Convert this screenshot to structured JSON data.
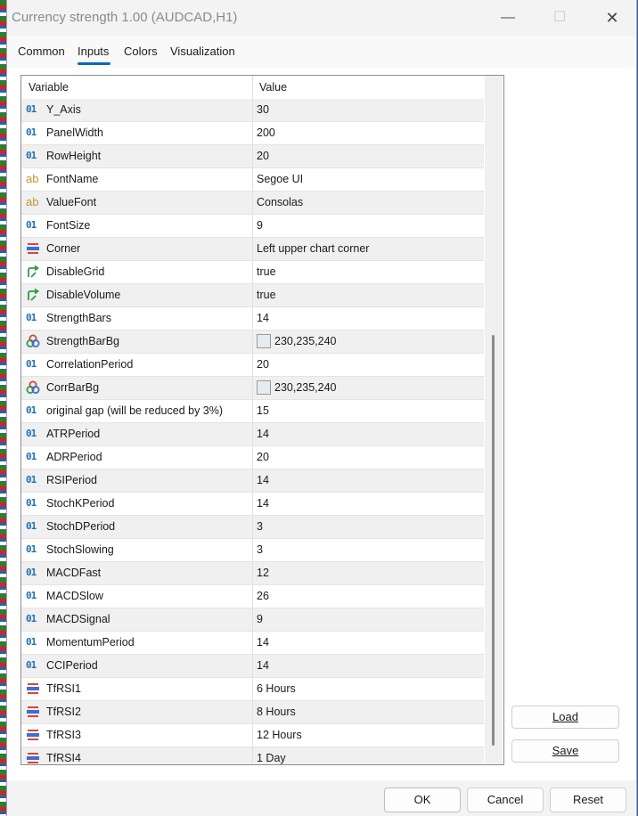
{
  "window": {
    "title": "Currency strength 1.00 (AUDCAD,H1)",
    "minimize_glyph": "—",
    "maximize_glyph": "☐",
    "close_glyph": "✕"
  },
  "tabs": [
    {
      "label": "Common"
    },
    {
      "label": "Inputs",
      "active": true
    },
    {
      "label": "Colors"
    },
    {
      "label": "Visualization"
    }
  ],
  "grid": {
    "col_variable": "Variable",
    "col_value": "Value",
    "rows": [
      {
        "icon": "integer-icon",
        "name": "Y_Axis",
        "value": "30"
      },
      {
        "icon": "integer-icon",
        "name": "PanelWidth",
        "value": "200"
      },
      {
        "icon": "integer-icon",
        "name": "RowHeight",
        "value": "20"
      },
      {
        "icon": "string-icon",
        "name": "FontName",
        "value": "Segoe UI"
      },
      {
        "icon": "string-icon",
        "name": "ValueFont",
        "value": "Consolas"
      },
      {
        "icon": "integer-icon",
        "name": "FontSize",
        "value": "9"
      },
      {
        "icon": "enum-icon",
        "name": "Corner",
        "value": "Left upper chart corner"
      },
      {
        "icon": "bool-icon",
        "name": "DisableGrid",
        "value": "true"
      },
      {
        "icon": "bool-icon",
        "name": "DisableVolume",
        "value": "true"
      },
      {
        "icon": "integer-icon",
        "name": "StrengthBars",
        "value": "14"
      },
      {
        "icon": "color-icon",
        "name": "StrengthBarBg",
        "value": "230,235,240",
        "swatch": "#e6ebf0"
      },
      {
        "icon": "integer-icon",
        "name": "CorrelationPeriod",
        "value": "20"
      },
      {
        "icon": "color-icon",
        "name": "CorrBarBg",
        "value": "230,235,240",
        "swatch": "#e6ebf0"
      },
      {
        "icon": "integer-icon",
        "name": "original gap (will be reduced by 3%)",
        "value": "15"
      },
      {
        "icon": "integer-icon",
        "name": "ATRPeriod",
        "value": "14"
      },
      {
        "icon": "integer-icon",
        "name": "ADRPeriod",
        "value": "20"
      },
      {
        "icon": "integer-icon",
        "name": "RSIPeriod",
        "value": "14"
      },
      {
        "icon": "integer-icon",
        "name": "StochKPeriod",
        "value": "14"
      },
      {
        "icon": "integer-icon",
        "name": "StochDPeriod",
        "value": "3"
      },
      {
        "icon": "integer-icon",
        "name": "StochSlowing",
        "value": "3"
      },
      {
        "icon": "integer-icon",
        "name": "MACDFast",
        "value": "12"
      },
      {
        "icon": "integer-icon",
        "name": "MACDSlow",
        "value": "26"
      },
      {
        "icon": "integer-icon",
        "name": "MACDSignal",
        "value": "9"
      },
      {
        "icon": "integer-icon",
        "name": "MomentumPeriod",
        "value": "14"
      },
      {
        "icon": "integer-icon",
        "name": "CCIPeriod",
        "value": "14"
      },
      {
        "icon": "enum-icon",
        "name": "TfRSI1",
        "value": "6 Hours"
      },
      {
        "icon": "enum-icon",
        "name": "TfRSI2",
        "value": "8 Hours"
      },
      {
        "icon": "enum-icon",
        "name": "TfRSI3",
        "value": "12 Hours"
      },
      {
        "icon": "enum-icon",
        "name": "TfRSI4",
        "value": "1 Day"
      }
    ]
  },
  "side_buttons": {
    "load_label": "Load",
    "save_label": "Save"
  },
  "footer": {
    "ok_label": "OK",
    "cancel_label": "Cancel",
    "reset_label": "Reset"
  },
  "icons": {
    "integer-icon": "01",
    "string-icon": "ab",
    "enum-icon": "≡",
    "bool-icon": "↱",
    "color-icon": "●●●"
  },
  "colors": {
    "accent": "#0067c0",
    "integer_icon": "#1f6fb5",
    "string_icon": "#c7932a",
    "bool_icon": "#2e9c46",
    "enum_icon_red": "#d9443b",
    "enum_icon_blue": "#3c6fd0"
  }
}
